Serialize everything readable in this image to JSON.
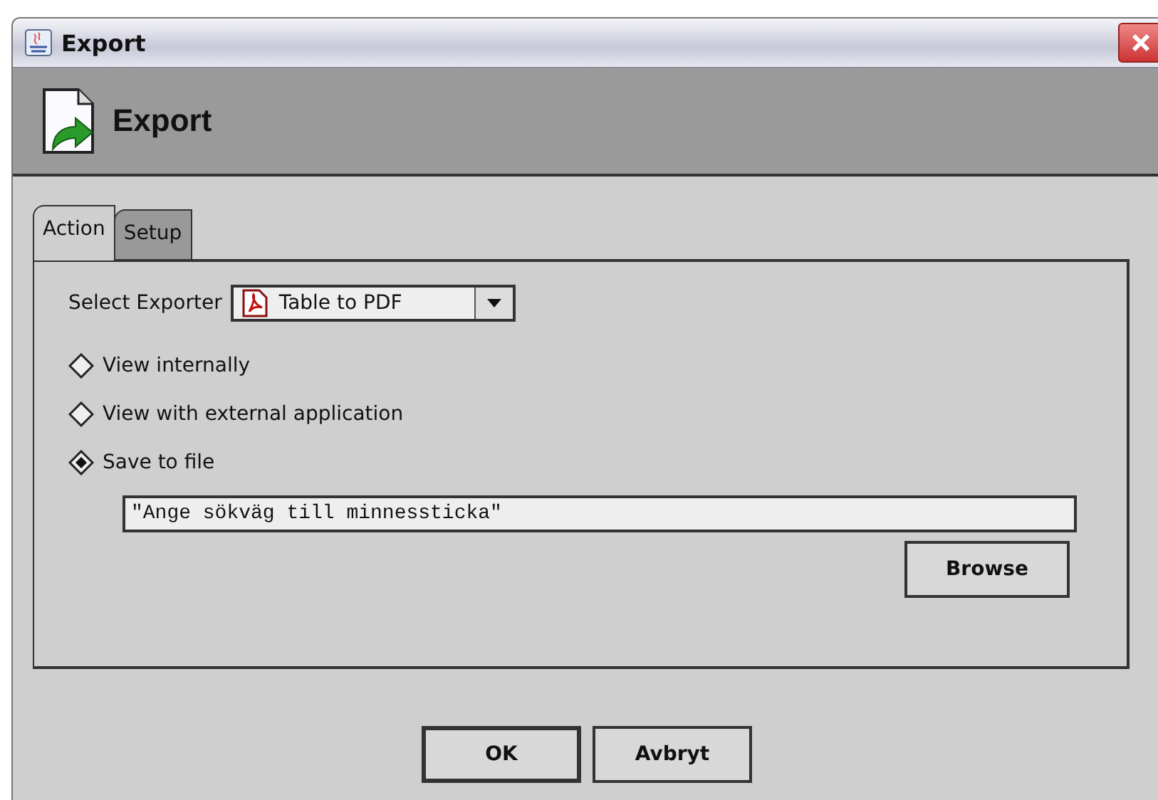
{
  "window": {
    "title": "Export"
  },
  "header": {
    "title": "Export"
  },
  "tabs": [
    {
      "label": "Action",
      "selected": true
    },
    {
      "label": "Setup",
      "selected": false
    }
  ],
  "exporter": {
    "label": "Select Exporter",
    "value": "Table to PDF"
  },
  "options": [
    {
      "label": "View internally",
      "selected": false
    },
    {
      "label": "View with external application",
      "selected": false
    },
    {
      "label": "Save to file",
      "selected": true
    }
  ],
  "path_field": {
    "value": "\"Ange sökväg till minnessticka\""
  },
  "browse_button": "Browse",
  "buttons": [
    "OK",
    "Avbryt"
  ]
}
